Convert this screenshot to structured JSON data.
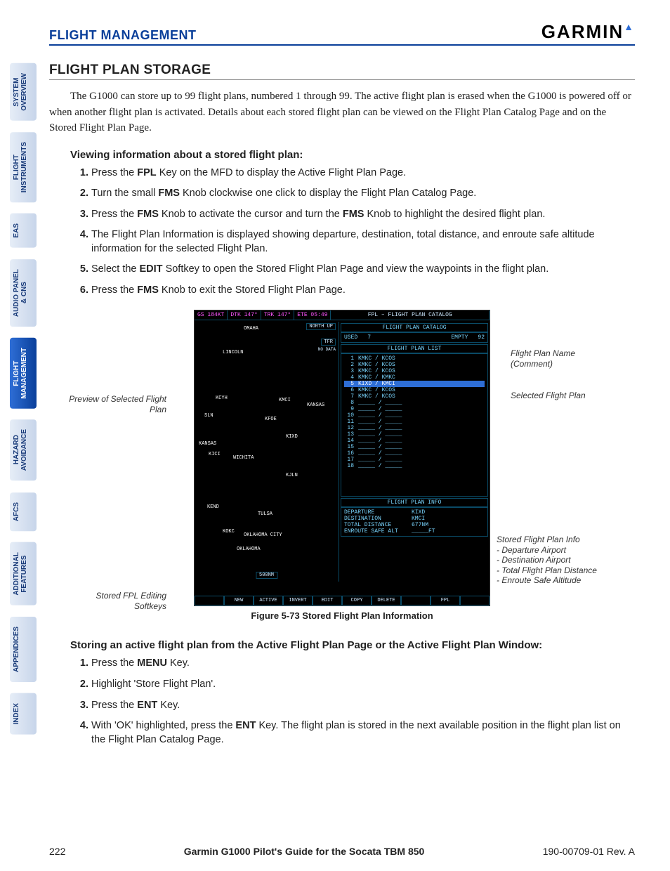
{
  "header": {
    "section": "FLIGHT MANAGEMENT",
    "brand": "GARMIN"
  },
  "tabs": [
    {
      "label": "SYSTEM\nOVERVIEW",
      "active": false
    },
    {
      "label": "FLIGHT\nINSTRUMENTS",
      "active": false
    },
    {
      "label": "EAS",
      "active": false
    },
    {
      "label": "AUDIO PANEL\n& CNS",
      "active": false
    },
    {
      "label": "FLIGHT\nMANAGEMENT",
      "active": true
    },
    {
      "label": "HAZARD\nAVOIDANCE",
      "active": false
    },
    {
      "label": "AFCS",
      "active": false
    },
    {
      "label": "ADDITIONAL\nFEATURES",
      "active": false
    },
    {
      "label": "APPENDICES",
      "active": false
    },
    {
      "label": "INDEX",
      "active": false
    }
  ],
  "section_title": "FLIGHT PLAN STORAGE",
  "intro": "The G1000 can store up to 99 flight plans, numbered 1 through 99.  The active flight plan is erased when the G1000 is powered off or when another flight plan is activated.  Details about each stored flight plan can be viewed on the Flight Plan Catalog Page and on the Stored Flight Plan Page.",
  "proc1_title": "Viewing information about a stored flight plan:",
  "proc1": [
    "Press the <b>FPL</b> Key on the MFD to display the Active Flight Plan Page.",
    "Turn the small <b>FMS</b> Knob clockwise one click to display the Flight Plan Catalog Page.",
    "Press the <b>FMS</b> Knob to activate the cursor and turn the <b>FMS</b> Knob to highlight the desired flight plan.",
    "The Flight Plan Information is displayed showing departure, destination, total distance, and enroute safe altitude information for the selected Flight Plan.",
    "Select the <b>EDIT</b> Softkey to open the Stored Flight Plan Page and view the waypoints in the flight plan.",
    "Press the <b>FMS</b> Knob to exit the Stored Flight Plan Page."
  ],
  "figure": {
    "caption": "Figure 5-73  Stored Flight Plan Information",
    "callouts": {
      "preview": "Preview of Selected Flight Plan",
      "softkeys": "Stored FPL Editing Softkeys",
      "name": "Flight Plan Name (Comment)",
      "selected": "Selected Flight Plan",
      "info": "Stored Flight Plan Info",
      "info_items": [
        "- Departure Airport",
        "- Destination Airport",
        "- Total Flight Plan Distance",
        "- Enroute Safe Altitude"
      ]
    },
    "screen": {
      "top": {
        "gs": "GS 184KT",
        "dtk": "DTK 147°",
        "trk": "TRK 147°",
        "ete": "ETE 05:49",
        "title": "FPL – FLIGHT PLAN CATALOG"
      },
      "catalog": {
        "title": "FLIGHT PLAN CATALOG",
        "used_lbl": "USED",
        "used": "7",
        "empty_lbl": "EMPTY",
        "empty": "92"
      },
      "list_title": "FLIGHT PLAN LIST",
      "list": [
        {
          "n": "1",
          "t": "KMKC / KCOS"
        },
        {
          "n": "2",
          "t": "KMKC / KCOS"
        },
        {
          "n": "3",
          "t": "KMKC / KCOS"
        },
        {
          "n": "4",
          "t": "KMKC / KMKC"
        },
        {
          "n": "5",
          "t": "KIXD / KMCI",
          "sel": true
        },
        {
          "n": "6",
          "t": "KMKC / KCOS"
        },
        {
          "n": "7",
          "t": "KMKC / KCOS"
        },
        {
          "n": "8",
          "t": "_____ / _____"
        },
        {
          "n": "9",
          "t": "_____ / _____"
        },
        {
          "n": "10",
          "t": "_____ / _____"
        },
        {
          "n": "11",
          "t": "_____ / _____"
        },
        {
          "n": "12",
          "t": "_____ / _____"
        },
        {
          "n": "13",
          "t": "_____ / _____"
        },
        {
          "n": "14",
          "t": "_____ / _____"
        },
        {
          "n": "15",
          "t": "_____ / _____"
        },
        {
          "n": "16",
          "t": "_____ / _____"
        },
        {
          "n": "17",
          "t": "_____ / _____"
        },
        {
          "n": "18",
          "t": "_____ / _____"
        }
      ],
      "info": {
        "title": "FLIGHT PLAN INFO",
        "dep_lbl": "DEPARTURE",
        "dep": "KIXD",
        "dst_lbl": "DESTINATION",
        "dst": "KMCI",
        "dist_lbl": "TOTAL DISTANCE",
        "dist": "677NM",
        "alt_lbl": "ENROUTE SAFE ALT",
        "alt": "_____FT"
      },
      "map_box": {
        "north": "NORTH UP",
        "tfr": "TFR",
        "nodata": "NO DATA",
        "scale": "500NM"
      },
      "map_labels": [
        "OMAHA",
        "LINCOLN",
        "KCYH",
        "KMCI",
        "KANSAS",
        "SLN",
        "KFOE",
        "KIXD",
        "KANSAS",
        "KICI",
        "WICHITA",
        "KJLN",
        "KEND",
        "TULSA",
        "KOKC",
        "OKLAHOMA CITY",
        "OKLAHOMA"
      ],
      "softkeys": [
        "",
        "NEW",
        "ACTIVE",
        "INVERT",
        "EDIT",
        "COPY",
        "DELETE",
        "",
        "FPL",
        ""
      ]
    }
  },
  "proc2_title": "Storing an active flight plan from the Active Flight Plan Page or the Active Flight Plan Window:",
  "proc2": [
    "Press the <b>MENU</b> Key.",
    "Highlight 'Store Flight Plan'.",
    "Press the <b>ENT</b> Key.",
    "With 'OK' highlighted, press the <b>ENT</b> Key.  The flight plan is stored in the next available position in the flight plan list on the Flight Plan Catalog Page."
  ],
  "footer": {
    "page": "222",
    "title": "Garmin G1000 Pilot's Guide for the Socata TBM 850",
    "rev": "190-00709-01  Rev. A"
  }
}
